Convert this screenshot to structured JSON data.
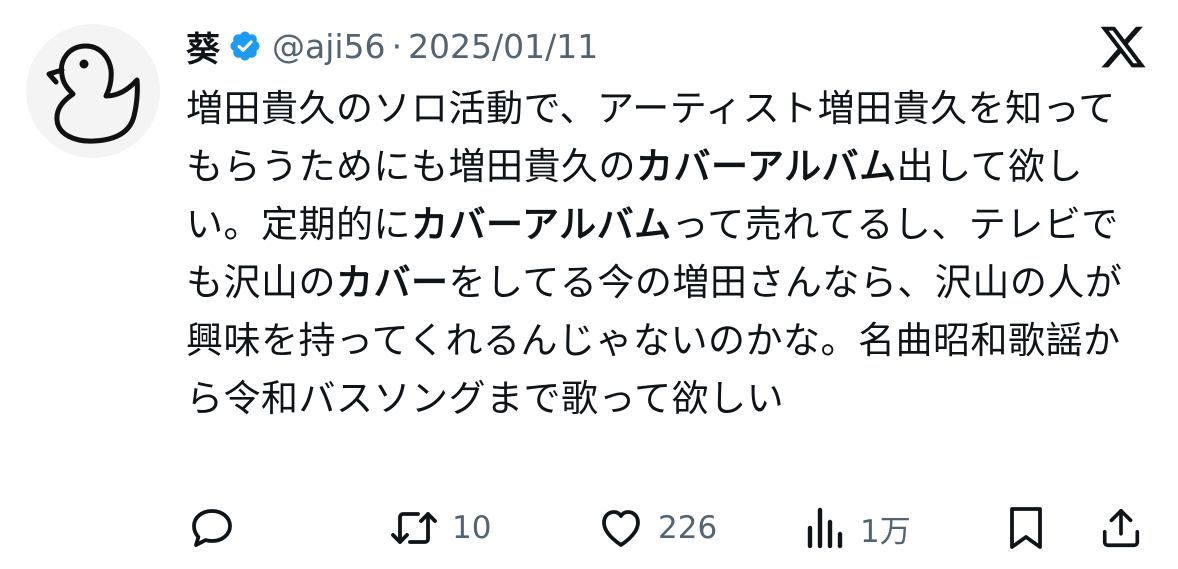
{
  "tweet": {
    "display_name": "葵",
    "handle": "@aji56",
    "separator": "·",
    "date": "2025/01/11",
    "avatar_icon": "duck-icon",
    "verified_icon": "verified-badge-icon",
    "platform_icon": "x-logo-icon",
    "text_segments": [
      {
        "text": "増田貴久のソロ活動で、アーティスト増田貴久を知ってもらうためにも増田貴久の",
        "bold": false
      },
      {
        "text": "カバーアルバム",
        "bold": true
      },
      {
        "text": "出して欲しい。定期的に",
        "bold": false
      },
      {
        "text": "カバーアルバム",
        "bold": true
      },
      {
        "text": "って売れてるし、テレビでも沢山の",
        "bold": false
      },
      {
        "text": "カバー",
        "bold": true
      },
      {
        "text": "をしてる今の増田さんなら、沢山の人が興味を持ってくれるんじゃないのかな。名曲昭和歌謡から令和バスソングまで歌って欲しい",
        "bold": false
      }
    ]
  },
  "actions": {
    "reply": {
      "icon": "reply-icon"
    },
    "retweet": {
      "icon": "retweet-icon",
      "count": "10"
    },
    "like": {
      "icon": "heart-icon",
      "count": "226"
    },
    "views": {
      "icon": "views-chart-icon",
      "count": "1万"
    },
    "bookmark": {
      "icon": "bookmark-icon"
    },
    "share": {
      "icon": "share-icon"
    }
  },
  "colors": {
    "text": "#0f1419",
    "secondary": "#536471",
    "verified": "#1d9bf0",
    "avatar_bg": "#f4f4f4"
  }
}
